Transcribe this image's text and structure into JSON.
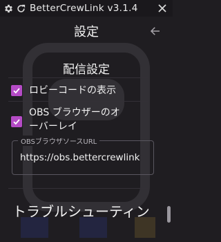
{
  "window": {
    "title": "BetterCrewLink v3.1.4"
  },
  "header": {
    "title": "設定"
  },
  "streaming": {
    "section_title": "配信設定",
    "lobby_code_label": "ロビーコードの表示",
    "obs_overlay_label_line1": "OBS ブラウザーのオ",
    "obs_overlay_label_line2": "ーバーレイ",
    "obs_url_field_label": "OBSブラウザソースURL",
    "obs_url_value": "https://obs.bettercrewlink"
  },
  "troubleshooting": {
    "title": "トラブルシューティン"
  },
  "colors": {
    "accent": "#b54bc6",
    "background": "#1f1d21",
    "titlebar": "#1a181c"
  },
  "icons": {
    "gear": "gear-icon",
    "refresh": "refresh-icon",
    "close": "close-icon",
    "back": "arrow-left-icon",
    "check": "check-icon"
  }
}
